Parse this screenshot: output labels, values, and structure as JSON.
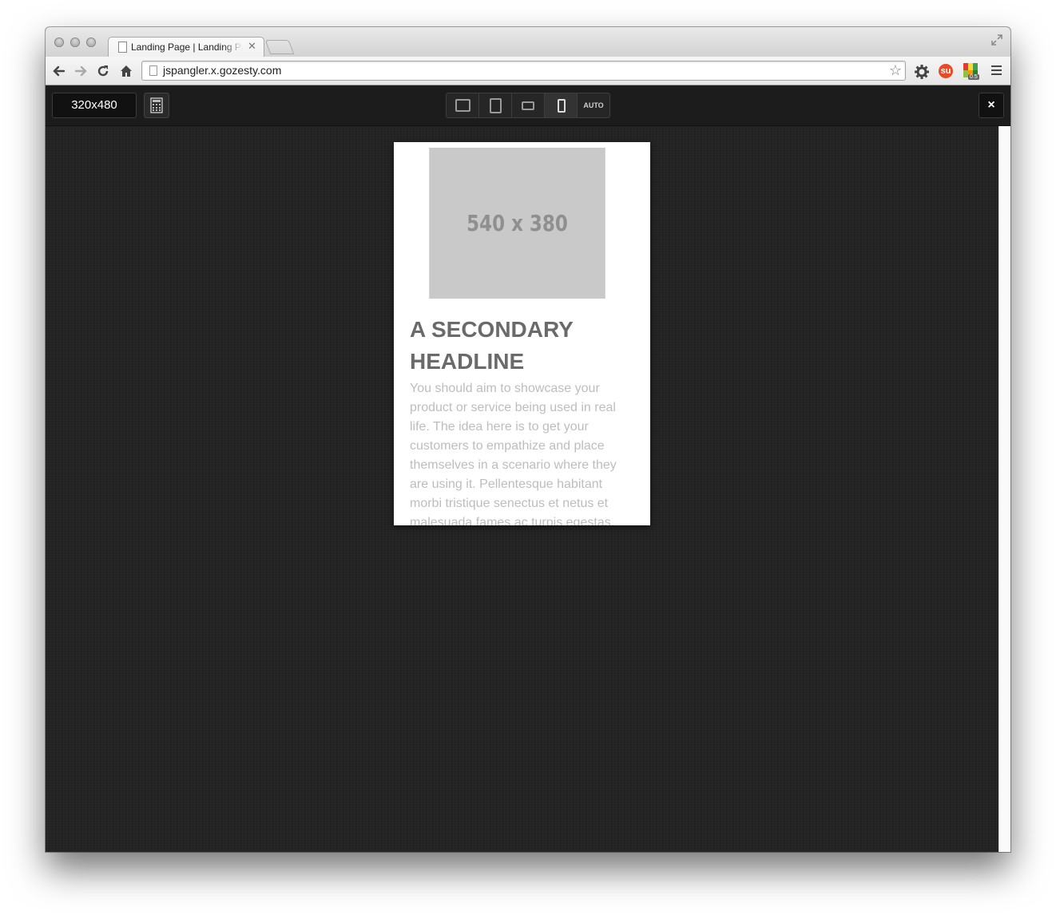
{
  "browser": {
    "tab_title": "Landing Page | Landing Page",
    "url": "jspangler.x.gozesty.com",
    "extensions": [
      "gear-icon",
      "stumbleupon-icon",
      "color-picker-icon",
      "menu-icon"
    ],
    "colorext_badge": "0.5"
  },
  "tester": {
    "size_label": "320x480",
    "devices": [
      {
        "name": "desktop",
        "label": ""
      },
      {
        "name": "tablet-portrait",
        "label": ""
      },
      {
        "name": "tablet-landscape",
        "label": ""
      },
      {
        "name": "phone",
        "label": ""
      },
      {
        "name": "auto",
        "label": "AUTO"
      }
    ],
    "close_label": "×"
  },
  "preview": {
    "placeholder_text": "540 x 380",
    "headline": "A SECONDARY HEADLINE",
    "body": "You should aim to showcase your product or service being used in real life. The idea here is to get your customers to empathize and place themselves in a scenario where they are using it. Pellentesque habitant morbi tristique senectus et netus et malesuada fames ac turpis egestas."
  },
  "colors": {
    "canvas_bg": "#242424",
    "placeholder_bg": "#c9c9c9",
    "headline": "#6a6a6a",
    "body_text": "#bdbdbd"
  }
}
